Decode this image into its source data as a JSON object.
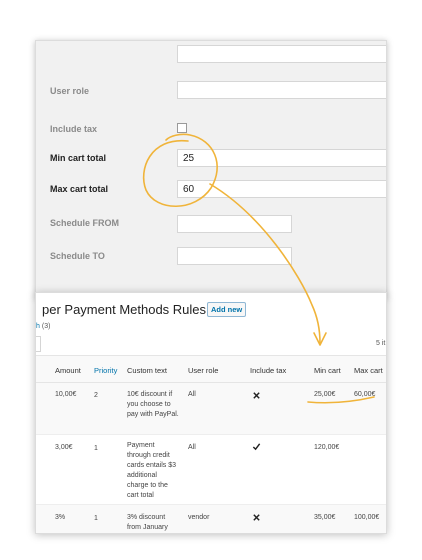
{
  "form": {
    "fields": [
      {
        "label": "User role",
        "value": ""
      },
      {
        "label": "Include tax",
        "value": ""
      },
      {
        "label": "Min cart total",
        "value": "25"
      },
      {
        "label": "Max cart total",
        "value": "60"
      },
      {
        "label": "Schedule FROM",
        "value": ""
      },
      {
        "label": "Schedule TO",
        "value": ""
      }
    ]
  },
  "rules": {
    "title": "per Payment Methods Rules",
    "add_new_label": "Add new",
    "filter_link": "h",
    "filter_count": "(3)",
    "items_count": "5 it",
    "columns": [
      "Amount",
      "Priority",
      "Custom text",
      "User role",
      "Include tax",
      "Min cart",
      "Max cart"
    ],
    "rows": [
      {
        "amount": "10,00€",
        "priority": "2",
        "custom_text": "10€ discount if you choose to pay with PayPal.",
        "user_role": "All",
        "include_tax": "x-icon",
        "min_cart": "25,00€",
        "max_cart": "60,00€"
      },
      {
        "amount": "3,00€",
        "priority": "1",
        "custom_text": "Payment through credit cards entails $3 additional charge to the cart total",
        "user_role": "All",
        "include_tax": "check-icon",
        "min_cart": "120,00€",
        "max_cart": ""
      },
      {
        "amount": "3%",
        "priority": "1",
        "custom_text": "3% discount from January",
        "user_role": "vendor",
        "include_tax": "x-icon",
        "min_cart": "35,00€",
        "max_cart": "100,00€"
      }
    ]
  },
  "colors": {
    "accent": "#0073aa",
    "annotation": "#f0b43a"
  }
}
